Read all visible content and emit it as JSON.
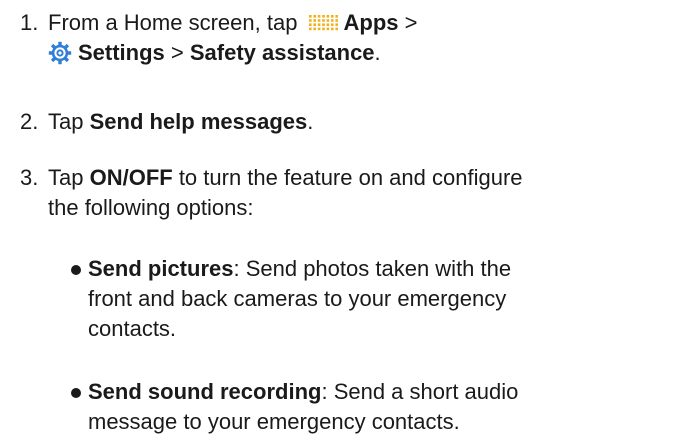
{
  "steps": [
    {
      "number": "1.",
      "line1_prefix": "From a Home screen, tap ",
      "apps_label": "Apps",
      "line1_suffix": " >",
      "settings_label": "Settings",
      "sep": " > ",
      "safety_label": "Safety assistance",
      "end": "."
    },
    {
      "number": "2.",
      "prefix": "Tap ",
      "bold": "Send help messages",
      "end": "."
    },
    {
      "number": "3.",
      "prefix": "Tap ",
      "bold": "ON/OFF",
      "rest_line1": " to turn the feature on and configure",
      "rest_line2": "the following options:"
    }
  ],
  "bullets": [
    {
      "bold": "Send pictures",
      "rest_line1": ": Send photos taken with the",
      "rest_line2": "front and back cameras to your emergency",
      "rest_line3": "contacts."
    },
    {
      "bold": "Send sound recording",
      "rest_line1": ": Send a short audio",
      "rest_line2": "message to your emergency contacts."
    }
  ],
  "icons": {
    "apps": "apps-grid-icon",
    "settings": "settings-gear-icon",
    "settings_color": "#2f7fd8",
    "apps_color": "#f0b21b"
  }
}
